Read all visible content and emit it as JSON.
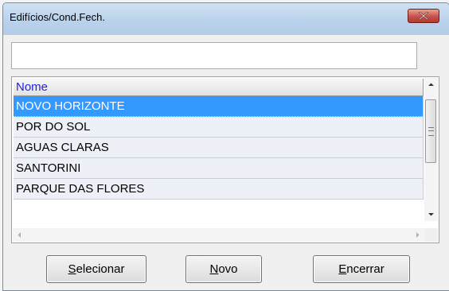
{
  "window": {
    "title": "Edifícios/Cond.Fech."
  },
  "search": {
    "value": ""
  },
  "list": {
    "header": "Nome",
    "rows": [
      "NOVO HORIZONTE",
      "POR DO SOL",
      "AGUAS CLARAS",
      "SANTORINI",
      "PARQUE DAS FLORES"
    ],
    "selected_index": 0
  },
  "buttons": {
    "selecionar": {
      "mnemonic": "S",
      "rest": "elecionar"
    },
    "novo": {
      "mnemonic": "N",
      "rest": "ovo"
    },
    "encerrar": {
      "mnemonic": "E",
      "rest": "ncerrar"
    }
  },
  "colors": {
    "selection": "#3399ff",
    "header_text": "#2323d8",
    "close_button": "#c75050"
  },
  "icons": [
    "close-icon",
    "scroll-up-icon",
    "scroll-down-icon",
    "scroll-left-icon",
    "scroll-right-icon"
  ]
}
